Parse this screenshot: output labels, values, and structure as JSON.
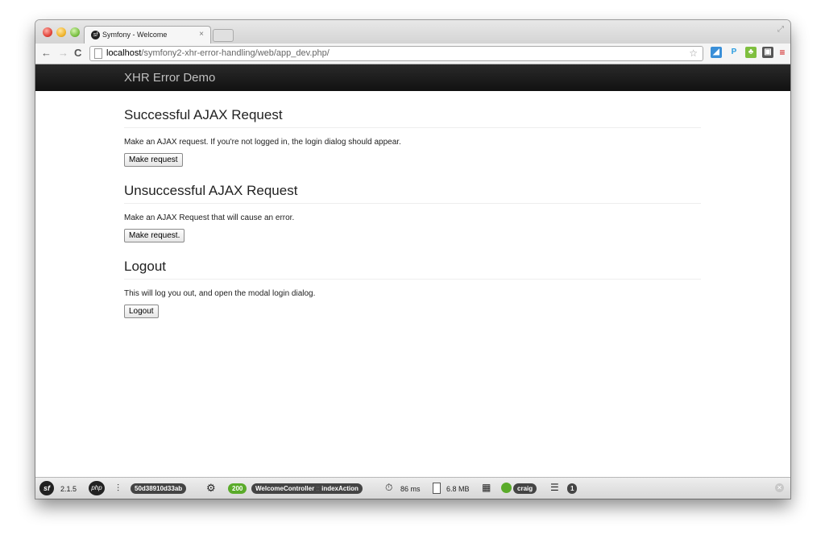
{
  "browser": {
    "tab_title": "Symfony - Welcome",
    "tab_close": "×",
    "url_host": "localhost",
    "url_path": "/symfony2-xhr-error-handling/web/app_dev.php/"
  },
  "page": {
    "brand": "XHR Error Demo",
    "sections": [
      {
        "heading": "Successful AJAX Request",
        "text": "Make an AJAX request. If you're not logged in, the login dialog should appear.",
        "button": "Make request"
      },
      {
        "heading": "Unsuccessful AJAX Request",
        "text": "Make an AJAX Request that will cause an error.",
        "button": "Make request."
      },
      {
        "heading": "Logout",
        "text": "This will log you out, and open the modal login dialog.",
        "button": "Logout"
      }
    ]
  },
  "debug_toolbar": {
    "symfony_version": "2.1.5",
    "php_label": "php",
    "token": "50d38910d33ab",
    "status_code": "200",
    "controller": "WelcomeController",
    "action": "indexAction",
    "time": "86 ms",
    "memory": "6.8 MB",
    "user": "craig",
    "db_queries": "1",
    "status_color": "#5aab2a"
  }
}
